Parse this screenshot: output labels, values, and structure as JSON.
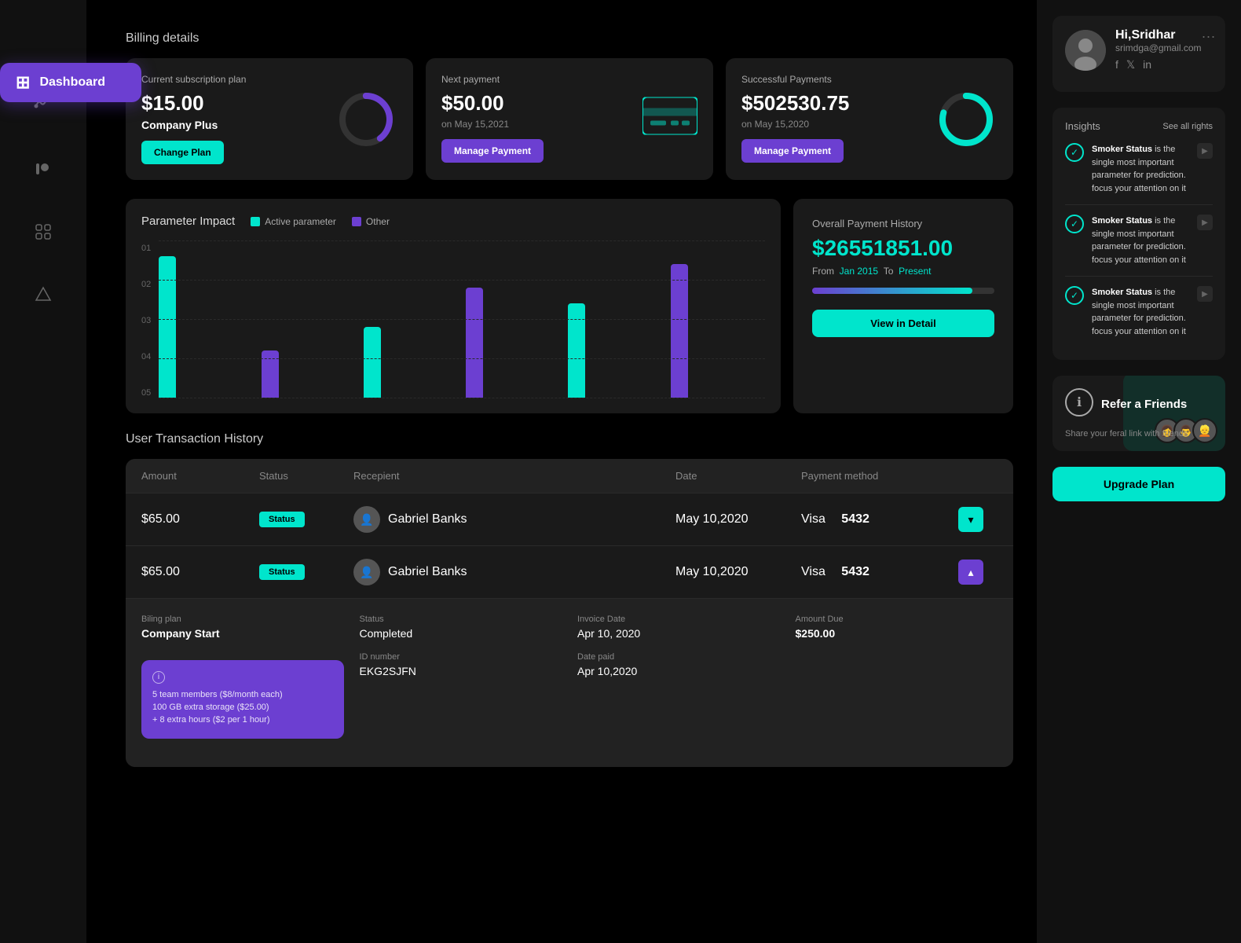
{
  "sidebar": {
    "items": [
      {
        "id": "dashboard",
        "icon": "⊞",
        "label": "Dashboard",
        "active": true
      },
      {
        "id": "analytics",
        "icon": "〜",
        "label": "Analytics",
        "active": false
      },
      {
        "id": "patreon",
        "icon": "◉",
        "label": "Patreon",
        "active": false
      },
      {
        "id": "grid",
        "icon": "⠿",
        "label": "Grid",
        "active": false
      },
      {
        "id": "shape",
        "icon": "⬡",
        "label": "Shape",
        "active": false
      }
    ],
    "active_label": "Dashboard"
  },
  "billing": {
    "title": "Billing details",
    "cards": [
      {
        "label": "Current subscription plan",
        "amount": "$15.00",
        "plan_name": "Company Plus",
        "btn_label": "Change Plan",
        "btn_type": "cyan"
      },
      {
        "label": "Next payment",
        "amount": "$50.00",
        "sub": "on May 15,2021",
        "btn_label": "Manage Payment",
        "btn_type": "purple"
      },
      {
        "label": "Successful Payments",
        "amount": "$502530.75",
        "sub": "on May 15,2020",
        "btn_label": "Manage Payment",
        "btn_type": "purple"
      }
    ]
  },
  "chart": {
    "title": "Parameter Impact",
    "legend": [
      {
        "label": "Active parameter",
        "color": "#00e5cc"
      },
      {
        "label": "Other",
        "color": "#6c3fd1"
      }
    ],
    "y_labels": [
      "01",
      "02",
      "03",
      "04",
      "05"
    ],
    "bars": [
      {
        "cyan": 180,
        "purple": 0
      },
      {
        "cyan": 0,
        "purple": 60
      },
      {
        "cyan": 90,
        "purple": 0
      },
      {
        "cyan": 0,
        "purple": 140
      },
      {
        "cyan": 120,
        "purple": 0
      },
      {
        "cyan": 0,
        "purple": 170
      }
    ]
  },
  "payment_history": {
    "title": "Overall Payment History",
    "amount": "$26551851.00",
    "from_label": "From",
    "from_date": "Jan 2015",
    "to_label": "To",
    "to_date": "Present",
    "progress": 88,
    "btn_label": "View in Detail"
  },
  "transactions": {
    "title": "User Transaction History",
    "headers": [
      "Amount",
      "Status",
      "Recepient",
      "Date",
      "Payment method",
      ""
    ],
    "rows": [
      {
        "amount": "$65.00",
        "status": "Status",
        "recipient": "Gabriel Banks",
        "date": "May 10,2020",
        "payment": "Visa",
        "card_last4": "5432",
        "expanded": false
      },
      {
        "amount": "$65.00",
        "status": "Status",
        "recipient": "Gabriel Banks",
        "date": "May 10,2020",
        "payment": "Visa",
        "card_last4": "5432",
        "expanded": true,
        "details": {
          "billing_plan_label": "Biling plan",
          "billing_plan": "Company Start",
          "status_label": "Status",
          "status_value": "Completed",
          "invoice_date_label": "Invoice Date",
          "invoice_date": "Apr 10, 2020",
          "amount_due_label": "Amount Due",
          "amount_due": "$250.00",
          "id_label": "ID number",
          "id_value": "EKG2SJFN",
          "date_paid_label": "Date paid",
          "date_paid": "Apr 10,2020"
        },
        "plan_details": {
          "members": "5 team members ($8/month each)",
          "storage": "100 GB extra storage ($25.00)",
          "hours": "+ 8 extra hours ($2 per 1 hour)"
        }
      }
    ]
  },
  "right_panel": {
    "profile": {
      "greeting": "Hi,Sridhar",
      "email": "srimdga@gmail.com",
      "social": [
        "f",
        "𝕏",
        "in"
      ]
    },
    "insights": {
      "title": "Insights",
      "see_all": "See all rights",
      "items": [
        {
          "bold": "Smoker Status",
          "text": " is the single most important parameter for prediction. focus your attention on it"
        },
        {
          "bold": "Smoker Status",
          "text": " is the single most important parameter for prediction. focus your attention on it"
        },
        {
          "bold": "Smoker Status",
          "text": " is the single most important parameter for prediction. focus your attention on it"
        }
      ]
    },
    "refer": {
      "title": "Refer a Friends",
      "subtitle": "Share your feral link with friends"
    },
    "upgrade_btn": "Upgrade Plan"
  }
}
